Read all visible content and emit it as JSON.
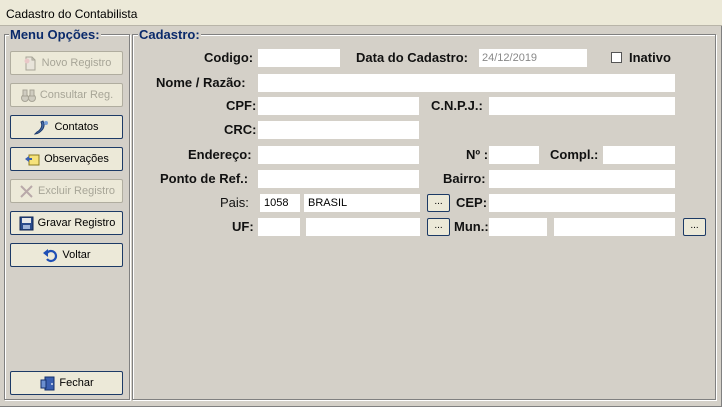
{
  "window": {
    "title": "Cadastro do Contabilista"
  },
  "menu": {
    "legend": "Menu Opções:",
    "buttons": [
      {
        "label": "Novo Registro",
        "icon": "new-document-icon",
        "enabled": false
      },
      {
        "label": "Consultar Reg.",
        "icon": "binoculars-icon",
        "enabled": false
      },
      {
        "label": "Contatos",
        "icon": "phone-icon",
        "enabled": true
      },
      {
        "label": "Observações",
        "icon": "notes-icon",
        "enabled": true
      },
      {
        "label": "Excluir Registro",
        "icon": "delete-x-icon",
        "enabled": false
      },
      {
        "label": "Gravar Registro",
        "icon": "save-disk-icon",
        "enabled": true
      },
      {
        "label": "Voltar",
        "icon": "undo-arrow-icon",
        "enabled": true
      },
      {
        "label": "Fechar",
        "icon": "exit-door-icon",
        "enabled": true
      }
    ]
  },
  "form": {
    "legend": "Cadastro:",
    "codigo": {
      "label": "Codigo:",
      "value": ""
    },
    "data_cadastro": {
      "label": "Data do Cadastro:",
      "value": "24/12/2019"
    },
    "inativo": {
      "label": "Inativo",
      "checked": false
    },
    "nome": {
      "label": "Nome / Razão:",
      "value": ""
    },
    "cpf": {
      "label": "CPF:",
      "value": ""
    },
    "cnpj": {
      "label": "C.N.P.J.:",
      "value": ""
    },
    "crc": {
      "label": "CRC:",
      "value": ""
    },
    "endereco": {
      "label": "Endereço:",
      "value": ""
    },
    "numero": {
      "label": "Nº :",
      "value": ""
    },
    "compl": {
      "label": "Compl.:",
      "value": ""
    },
    "ponto_ref": {
      "label": "Ponto de Ref.:",
      "value": ""
    },
    "bairro": {
      "label": "Bairro:",
      "value": ""
    },
    "pais": {
      "label": "Pais:",
      "code": "1058",
      "name": "BRASIL",
      "lookup": "..."
    },
    "cep": {
      "label": "CEP:",
      "value": ""
    },
    "uf": {
      "label": "UF:",
      "value": "",
      "name": "",
      "lookup": "..."
    },
    "mun": {
      "label": "Mun.:",
      "code": "",
      "name": "",
      "lookup": "..."
    }
  },
  "colors": {
    "legend": "#0a2a6b",
    "background": "#d4d0c8",
    "button_border": "#1c3a66"
  }
}
